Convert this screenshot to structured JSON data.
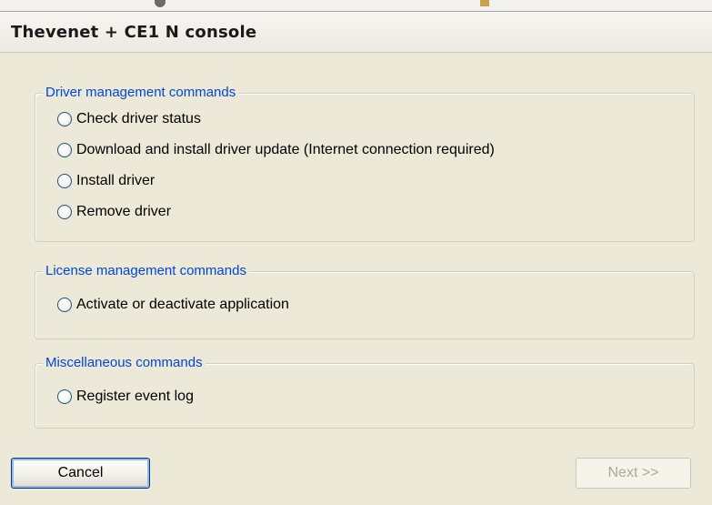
{
  "window": {
    "title": "Thevenet + CE1 N console"
  },
  "groups": [
    {
      "legend": "Driver management commands",
      "options": [
        "Check driver status",
        "Download and install driver update (Internet connection required)",
        "Install driver",
        "Remove driver"
      ]
    },
    {
      "legend": "License management commands",
      "options": [
        "Activate or deactivate application"
      ]
    },
    {
      "legend": "Miscellaneous commands",
      "options": [
        "Register event log"
      ]
    }
  ],
  "buttons": {
    "cancel_label": "Cancel",
    "next_label": "Next >>",
    "next_enabled": false
  },
  "colors": {
    "group_legend": "#0046d5",
    "dialog_background": "#ece9d8",
    "disabled_text": "#aca899"
  }
}
